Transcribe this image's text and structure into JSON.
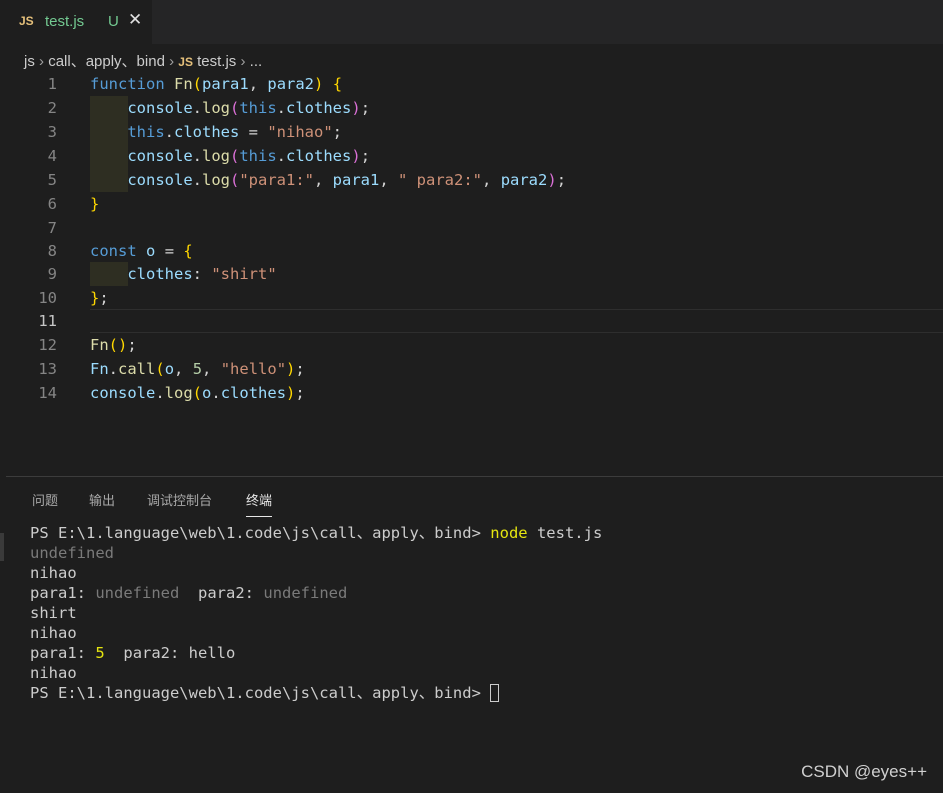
{
  "tab": {
    "icon": "JS",
    "filename": "test.js",
    "status": "U",
    "close": "✕"
  },
  "breadcrumb": {
    "folder1": "js",
    "folder2": "call、apply、bind",
    "file_icon": "JS",
    "file": "test.js",
    "more": "...",
    "sep": "›"
  },
  "editor": {
    "line_numbers": [
      "1",
      "2",
      "3",
      "4",
      "5",
      "6",
      "7",
      "8",
      "9",
      "10",
      "11",
      "12",
      "13",
      "14"
    ],
    "lines": [
      "function Fn(para1, para2) {",
      "    console.log(this.clothes);",
      "    this.clothes = \"nihao\";",
      "    console.log(this.clothes);",
      "    console.log(\"para1:\", para1, \" para2:\", para2);",
      "}",
      "",
      "const o = {",
      "    clothes: \"shirt\"",
      "};",
      "",
      "Fn();",
      "Fn.call(o, 5, \"hello\");",
      "console.log(o.clothes);"
    ],
    "active_line": "11"
  },
  "panel": {
    "tabs": [
      "问题",
      "输出",
      "调试控制台",
      "终端"
    ],
    "active_tab": "终端"
  },
  "terminal": {
    "prompt": "PS E:\\1.language\\web\\1.code\\js\\call、apply、bind>",
    "command": "node",
    "command_arg": "test.js",
    "output": {
      "l1": "undefined",
      "l2": "nihao",
      "l3_a": "para1:",
      "l3_b": "undefined",
      "l3_c": "para2:",
      "l3_d": "undefined",
      "l4": "shirt",
      "l5": "nihao",
      "l6_a": "para1:",
      "l6_b": "5",
      "l6_c": "para2: hello",
      "l7": "nihao"
    },
    "prompt2": "PS E:\\1.language\\web\\1.code\\js\\call、apply、bind>"
  },
  "watermark": "CSDN @eyes++",
  "colors": {
    "keyword": "#569cd6",
    "function": "#dcdcaa",
    "variable": "#9cdcfe",
    "string": "#ce9178",
    "number": "#b5cea8",
    "bracket": "#ffd700",
    "modified": "#73c991"
  }
}
